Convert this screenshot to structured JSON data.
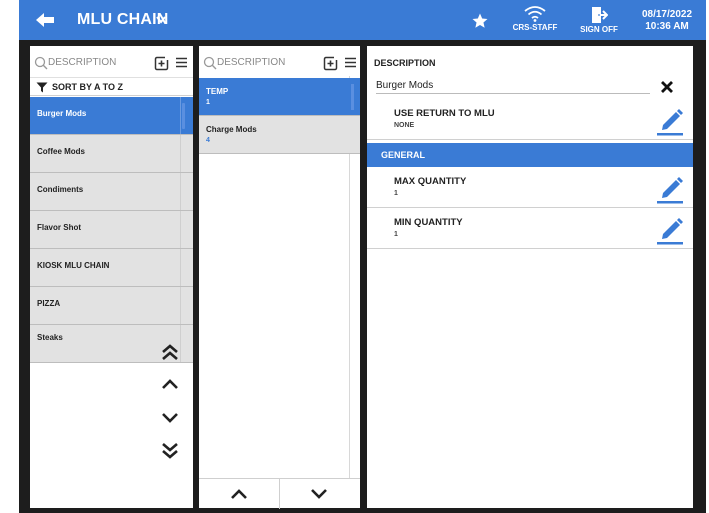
{
  "topbar": {
    "title": "MLU CHAIN",
    "wifi_label": "CRS-STAFF",
    "signoff_label": "SIGN OFF",
    "date": "08/17/2022",
    "time": "10:36 AM",
    "accent_color": "#3a7bd5"
  },
  "panel1": {
    "search_placeholder": "DESCRIPTION",
    "sort_label": "SORT BY A TO Z",
    "items": [
      {
        "label": "Burger Mods",
        "selected": true
      },
      {
        "label": "Coffee Mods"
      },
      {
        "label": "Condiments"
      },
      {
        "label": "Flavor Shot"
      },
      {
        "label": "KIOSK MLU CHAIN"
      },
      {
        "label": "PIZZA"
      },
      {
        "label": "Steaks"
      }
    ]
  },
  "panel2": {
    "search_placeholder": "DESCRIPTION",
    "items": [
      {
        "label": "TEMP",
        "count": "1",
        "selected": true
      },
      {
        "label": "Charge Mods",
        "count": "4"
      }
    ]
  },
  "panel3": {
    "description_label": "DESCRIPTION",
    "description_value": "Burger Mods",
    "use_return_label": "USE RETURN TO MLU",
    "use_return_value": "NONE",
    "section_general": "GENERAL",
    "max_qty_label": "MAX QUANTITY",
    "max_qty_value": "1",
    "min_qty_label": "MIN QUANTITY",
    "min_qty_value": "1"
  }
}
